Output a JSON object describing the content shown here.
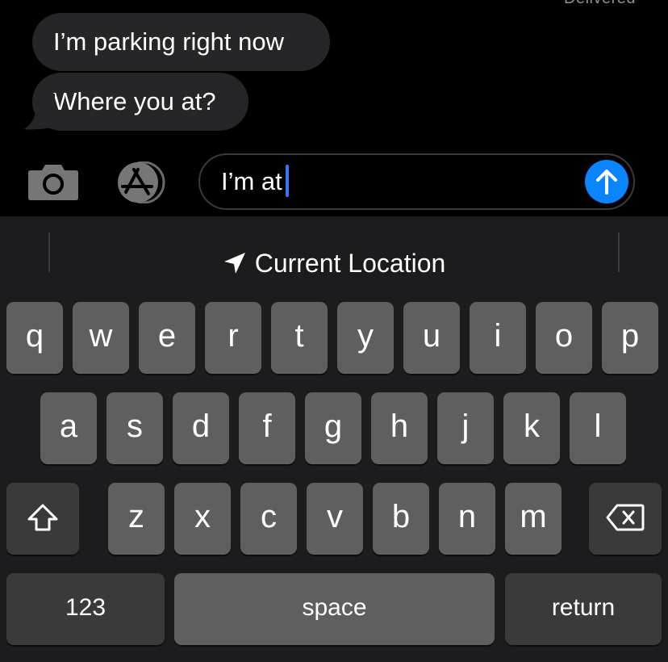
{
  "conversation": {
    "status_text": "Delivered",
    "messages": [
      {
        "sender": "other",
        "text": "I’m parking right now"
      },
      {
        "sender": "other",
        "text": "Where you at?"
      }
    ]
  },
  "input_bar": {
    "camera_icon": "camera-icon",
    "apps_icon": "app-store-icon",
    "composer_value": "I’m at",
    "send_icon": "arrow-up-icon",
    "send_color": "#0a84ff"
  },
  "keyboard": {
    "suggestion": {
      "icon": "location-arrow-icon",
      "label": "Current Location"
    },
    "rows": [
      [
        "q",
        "w",
        "e",
        "r",
        "t",
        "y",
        "u",
        "i",
        "o",
        "p"
      ],
      [
        "a",
        "s",
        "d",
        "f",
        "g",
        "h",
        "j",
        "k",
        "l"
      ],
      [
        "z",
        "x",
        "c",
        "v",
        "b",
        "n",
        "m"
      ]
    ],
    "shift_icon": "shift-icon",
    "delete_icon": "delete-backspace-icon",
    "numbers_label": "123",
    "space_label": "space",
    "return_label": "return"
  }
}
